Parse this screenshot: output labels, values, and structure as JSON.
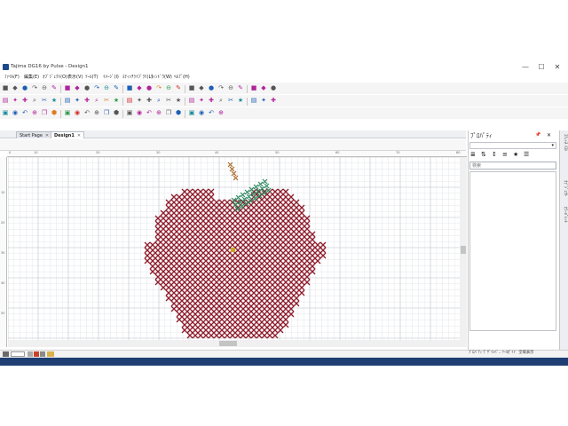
{
  "window": {
    "title": "Tajima DG16 by Pulse - Design1",
    "controls": [
      "—",
      "☐",
      "✕"
    ]
  },
  "menu": [
    "ﾌｧｲﾙ(F)",
    "編集(E)",
    "ｵﾌﾞｼﾞｪｸﾄ(O)",
    "表示(V)",
    "ﾂｰﾙ(T)",
    "ｲﾒｰｼﾞ(I)",
    "ｽﾃｨｯﾁﾗｲﾌﾞﾗﾘ(L)",
    "ｳｨﾝﾄﾞｳ(W)",
    "ﾍﾙﾌﾟ(H)"
  ],
  "doc_tabs": [
    {
      "label": "Start Page",
      "close": "✕"
    },
    {
      "label": "Design1",
      "close": "✕",
      "active": true
    }
  ],
  "ruler": {
    "top": [
      "0",
      "10",
      "20",
      "30",
      "40",
      "50",
      "60",
      "70",
      "80",
      "90"
    ],
    "left": [
      "10",
      "20",
      "30",
      "40",
      "50"
    ]
  },
  "design": {
    "fill_color": "#8e1b2b",
    "leaf_color": "#2e8a62",
    "stem_color": "#a86a2a",
    "grid_major": "#c2c8cf",
    "grid_minor": "#e3e6ea",
    "cursor_color": "#c8a228"
  },
  "panel": {
    "title": "ﾌﾟﾛﾊﾟﾃｨ",
    "tools": [
      "≣",
      "⇅",
      "↕",
      "≡",
      "★",
      "☰"
    ],
    "search_placeholder": "検索",
    "pin": "📌",
    "close": "✕",
    "bottom_tabs": "ﾌﾟﾛﾊﾟﾃｨ ﾃﾞｻﾞｲﾝﾊﾟ.. ﾂｰﾙｶﾞｲﾄﾞ 全域表示"
  },
  "side_tabs": [
    "ｽﾃｨｯﾁ ﾘｽﾄ",
    "ｵﾌﾞｼﾞｪｸﾄ",
    "ｶﾗｰﾊﾟﾚｯﾄ"
  ],
  "status": {
    "zoom_label": "",
    "zoom_value": ""
  },
  "toolbar_icons": {
    "row1": [
      "new-icon",
      "open-icon",
      "save-icon",
      "print-icon",
      "cut-icon",
      "copy-icon",
      "paste-icon",
      "undo-icon",
      "redo-icon",
      "zoom-in-icon",
      "zoom-out-icon"
    ],
    "colors": {
      "magenta": "#b0259a",
      "orange": "#e07a1f",
      "blue": "#1e5fb4",
      "green": "#2a9a4a",
      "teal": "#1a8a9a",
      "gray": "#555555",
      "red": "#d42a2a"
    }
  }
}
